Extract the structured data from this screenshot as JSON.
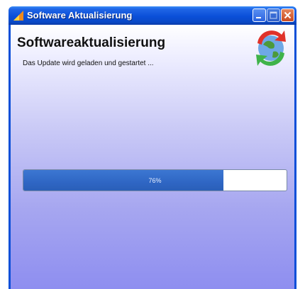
{
  "window": {
    "title": "Software Aktualisierung",
    "icons": {
      "app": "app-icon",
      "minimize": "minimize-icon",
      "maximize": "maximize-icon",
      "close": "close-icon"
    }
  },
  "content": {
    "heading": "Softwareaktualisierung",
    "subtext": "Das Update wird geladen und gestartet ...",
    "icon": "update-refresh-icon"
  },
  "progress": {
    "label": "76%",
    "value": 0.76
  },
  "colors": {
    "titlebar": "#0a4fd8",
    "progress_fill": "#2f66c4",
    "close_button": "#c94a22"
  }
}
